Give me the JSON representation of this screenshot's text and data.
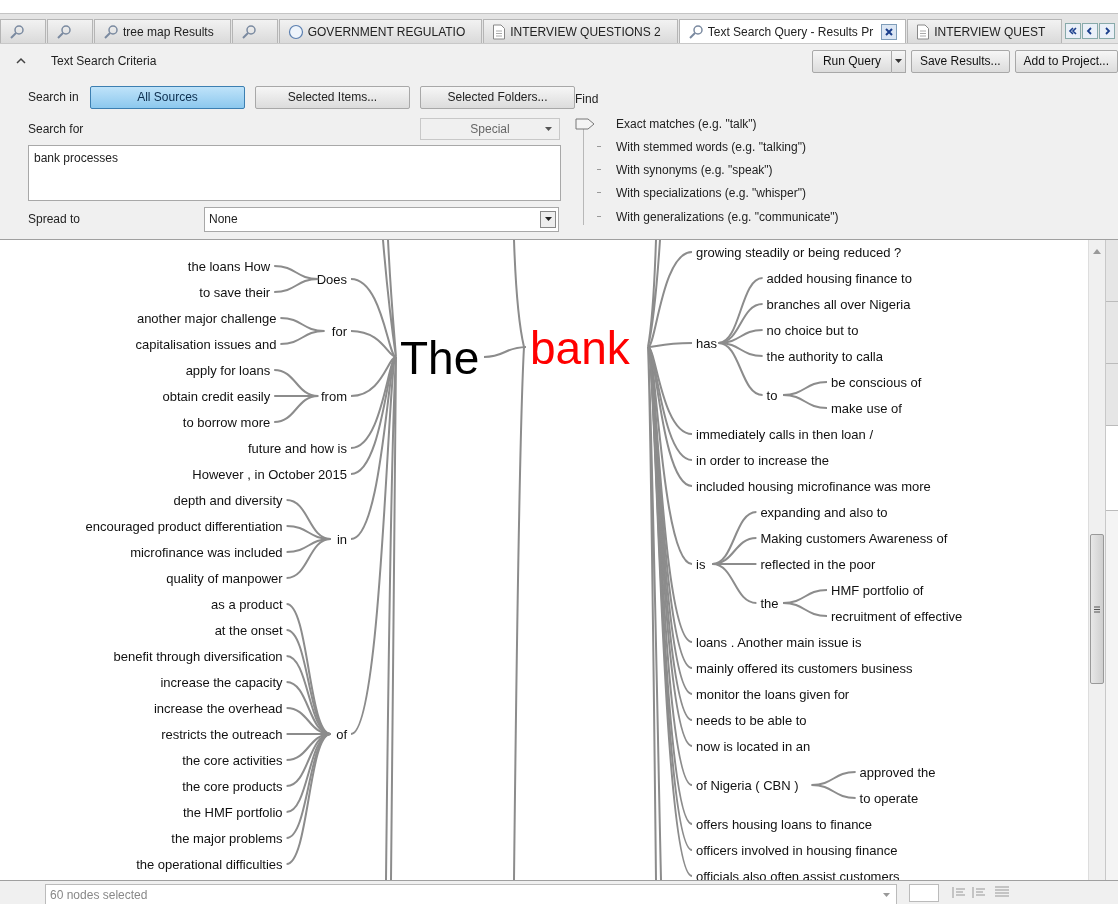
{
  "tabs": [
    {
      "kind": "query",
      "selected": false
    },
    {
      "kind": "query",
      "selected": false
    },
    {
      "kind": "query",
      "label": "tree map Results",
      "selected": false
    },
    {
      "kind": "query",
      "selected": false
    },
    {
      "kind": "circle",
      "label": "GOVERNMENT REGULATIO",
      "selected": false
    },
    {
      "kind": "document",
      "label": "INTERVIEW QUESTIONS 2",
      "selected": false
    },
    {
      "kind": "query",
      "label": "Text Search Query - Results Pr",
      "selected": true,
      "closable": true
    },
    {
      "kind": "document",
      "label": "INTERVIEW QUEST",
      "selected": false
    }
  ],
  "criteria": {
    "title": "Text Search Criteria",
    "expanded": true,
    "actions": [
      {
        "label": "Run Query",
        "kind": "split"
      },
      {
        "label": "Save Results...",
        "kind": "plain"
      },
      {
        "label": "Add to Project...",
        "kind": "plain"
      }
    ],
    "search_in": {
      "label": "Search in",
      "options": [
        {
          "label": "All Sources",
          "selected": true
        },
        {
          "label": "Selected Items...",
          "selected": false
        },
        {
          "label": "Selected Folders...",
          "selected": false
        }
      ]
    },
    "search_for": {
      "label": "Search for",
      "special": "Special",
      "value": "bank processes"
    },
    "spread_to": {
      "label": "Spread to",
      "value": "None"
    },
    "find": {
      "label": "Find",
      "options": [
        {
          "label": "Exact matches (e.g. \"talk\")",
          "selected": true
        },
        {
          "label": "With stemmed words (e.g. \"talking\")",
          "selected": false
        },
        {
          "label": "With synonyms (e.g. \"speak\")",
          "selected": false
        },
        {
          "label": "With specializations (e.g. \"whisper\")",
          "selected": false
        },
        {
          "label": "With generalizations (e.g. \"communicate\")",
          "selected": false
        }
      ]
    }
  },
  "word_tree": {
    "left_root": "The",
    "root": "bank",
    "left": [
      {
        "text": "Does",
        "children": [
          {
            "text": "the loans How"
          },
          {
            "text": "to save their"
          }
        ]
      },
      {
        "text": "for",
        "children": [
          {
            "text": "another major challenge"
          },
          {
            "text": "capitalisation issues and"
          }
        ]
      },
      {
        "text": "from",
        "children": [
          {
            "text": "apply for loans"
          },
          {
            "text": "obtain credit easily"
          },
          {
            "text": "to borrow more"
          }
        ]
      },
      {
        "text": "future and how is"
      },
      {
        "text": "However , in October 2015"
      },
      {
        "text": "in",
        "children": [
          {
            "text": "depth and diversity"
          },
          {
            "text": "encouraged product differentiation"
          },
          {
            "text": "microfinance was included"
          },
          {
            "text": "quality of manpower"
          }
        ]
      },
      {
        "text": "of",
        "children": [
          {
            "text": "as a product"
          },
          {
            "text": "at the onset"
          },
          {
            "text": "benefit through diversification"
          },
          {
            "text": "increase the capacity"
          },
          {
            "text": "increase the overhead"
          },
          {
            "text": "restricts the outreach"
          },
          {
            "text": "the core activities"
          },
          {
            "text": "the core products"
          },
          {
            "text": "the HMF portfolio"
          },
          {
            "text": "the major problems"
          },
          {
            "text": "the operational difficulties"
          }
        ]
      }
    ],
    "right": [
      {
        "text": "growing steadily or being reduced ?"
      },
      {
        "text": "has",
        "children": [
          {
            "text": "added housing finance to"
          },
          {
            "text": "branches all over Nigeria"
          },
          {
            "text": "no choice but to"
          },
          {
            "text": "the authority to calla"
          },
          {
            "text": "to",
            "children": [
              {
                "text": "be conscious of"
              },
              {
                "text": "make use of"
              }
            ]
          }
        ]
      },
      {
        "text": "immediately calls in then loan /"
      },
      {
        "text": "in order to increase the"
      },
      {
        "text": "included housing microfinance was more"
      },
      {
        "text": "is",
        "children": [
          {
            "text": "expanding and also to"
          },
          {
            "text": "Making customers Awareness of"
          },
          {
            "text": "reflected in the poor"
          },
          {
            "text": "the",
            "children": [
              {
                "text": "HMF portfolio of"
              },
              {
                "text": "recruitment of effective"
              }
            ]
          }
        ]
      },
      {
        "text": "loans . Another main issue is"
      },
      {
        "text": "mainly offered its customers business"
      },
      {
        "text": "monitor the loans given for"
      },
      {
        "text": "needs to be able to"
      },
      {
        "text": "now is located in an"
      },
      {
        "text": "of Nigeria ( CBN )",
        "children": [
          {
            "text": "approved the"
          },
          {
            "text": "to operate"
          }
        ]
      },
      {
        "text": "offers housing loans to finance"
      },
      {
        "text": "officers involved in housing finance"
      },
      {
        "text": "officials also often assist customers"
      }
    ]
  },
  "side_tabs": [
    {
      "selected": false
    },
    {
      "selected": false
    },
    {
      "selected": false
    },
    {
      "selected": true
    }
  ],
  "status": {
    "selection": "60 nodes selected"
  }
}
